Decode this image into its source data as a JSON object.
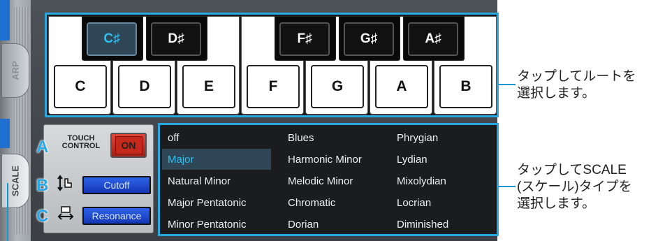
{
  "side_tabs": {
    "arp": "ARP",
    "scale": "SCALE"
  },
  "keyboard": {
    "white_keys": [
      "C",
      "D",
      "E",
      "F",
      "G",
      "A",
      "B"
    ],
    "black_keys": [
      "C♯",
      "D♯",
      "F♯",
      "G♯",
      "A♯"
    ],
    "selected_root": "C♯"
  },
  "touch_control": {
    "title_line1": "TOUCH",
    "title_line2": "CONTROL",
    "on_label": "ON",
    "cutoff_label": "Cutoff",
    "resonance_label": "Resonance",
    "markers": [
      "A",
      "B",
      "C"
    ]
  },
  "scale_list": {
    "items": [
      [
        "off",
        "Blues",
        "Phrygian"
      ],
      [
        "Major",
        "Harmonic Minor",
        "Lydian"
      ],
      [
        "Natural Minor",
        "Melodic Minor",
        "Mixolydian"
      ],
      [
        "Major Pentatonic",
        "Chromatic",
        "Locrian"
      ],
      [
        "Minor Pentatonic",
        "Dorian",
        "Diminished"
      ]
    ],
    "selected": "Major"
  },
  "callouts": {
    "root_line1": "タップしてルートを",
    "root_line2": "選択します。",
    "scale_line1": "タップしてSCALE",
    "scale_line2": "(スケール)タイプを",
    "scale_line3": "選択します。"
  },
  "colors": {
    "accent": "#27a8e0",
    "selected_text": "#2ec1f0",
    "on_button": "#c7281c",
    "param_button": "#1f4bd0"
  }
}
